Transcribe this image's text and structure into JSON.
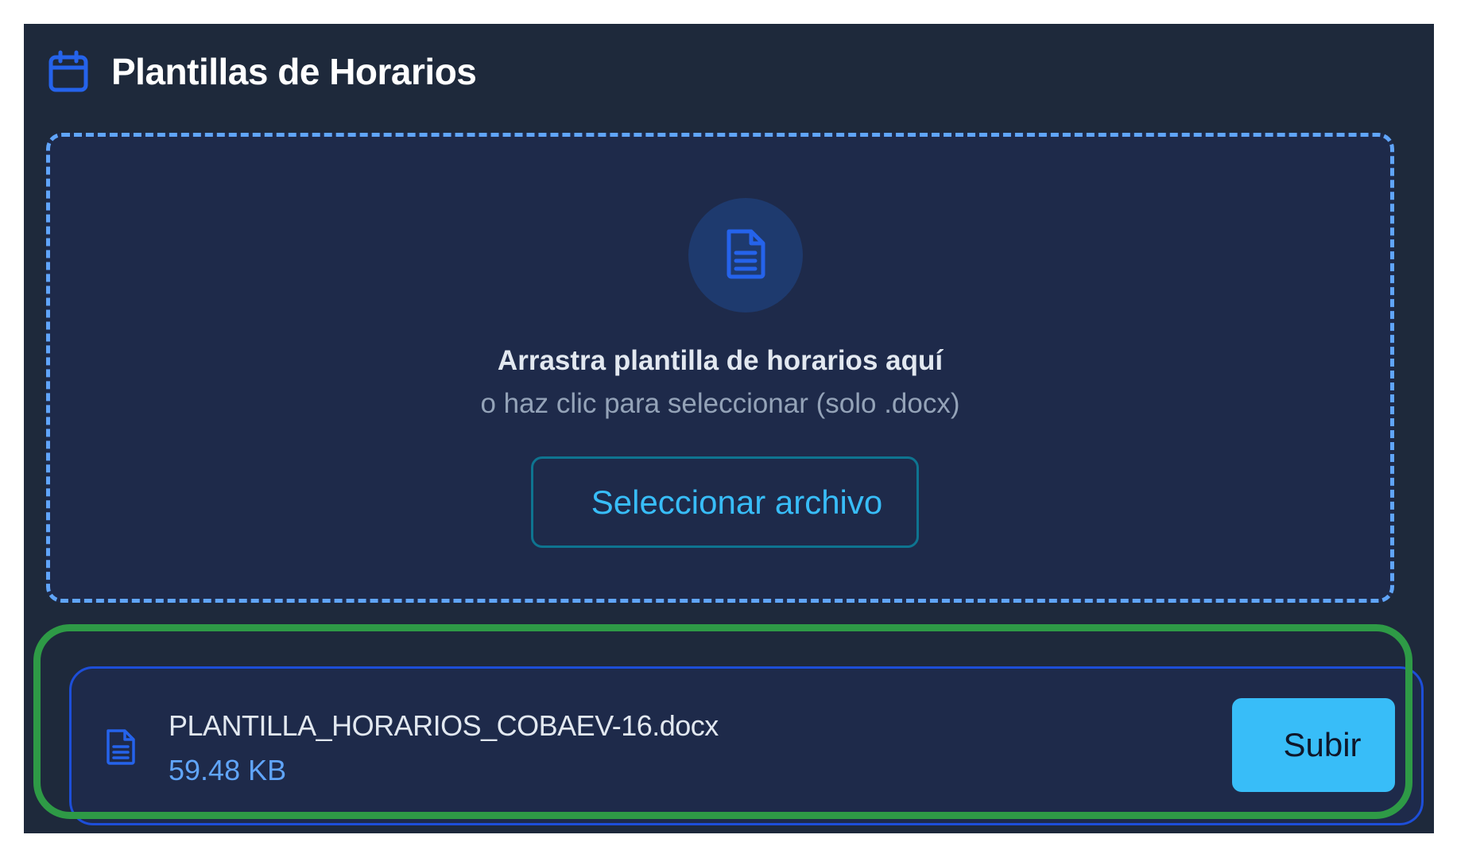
{
  "header": {
    "title": "Plantillas de Horarios",
    "icon": "calendar-icon"
  },
  "dropzone": {
    "icon": "document-icon",
    "title": "Arrastra plantilla de horarios aquí",
    "subtitle": "o haz clic para seleccionar (solo .docx)",
    "button_label": "Seleccionar archivo"
  },
  "file": {
    "icon": "document-icon",
    "name": "PLANTILLA_HORARIOS_COBAEV-16.docx",
    "size": "59.48 KB",
    "upload_label": "Subir"
  },
  "colors": {
    "panel_bg": "#1e293b",
    "accent_blue": "#60a5fa",
    "button_cyan": "#38bdf8",
    "highlight_green": "#2e9a46"
  }
}
